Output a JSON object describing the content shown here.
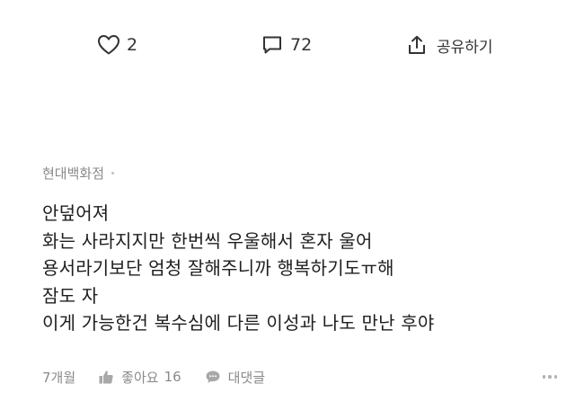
{
  "actions": {
    "like_count": "2",
    "comment_count": "72",
    "share_label": "공유하기"
  },
  "comment": {
    "author": "현대백화점",
    "lines": [
      "안덮어져",
      "화는 사라지지만 한번씩 우울해서 혼자 울어",
      "용서라기보단 엄청 잘해주니까 행복하기도ㅠ해",
      "잠도 자",
      "이게 가능한건 복수심에 다른 이성과 나도 만난 후야"
    ],
    "time": "7개월",
    "like_label": "좋아요",
    "like_count": "16",
    "reply_label": "대댓글"
  },
  "icons": {
    "heart": "heart-outline-icon",
    "comment": "speech-bubble-icon",
    "share": "share-icon",
    "thumbs_up": "thumbs-up-icon",
    "reply": "reply-bubble-icon",
    "more": "more-dots-icon"
  }
}
